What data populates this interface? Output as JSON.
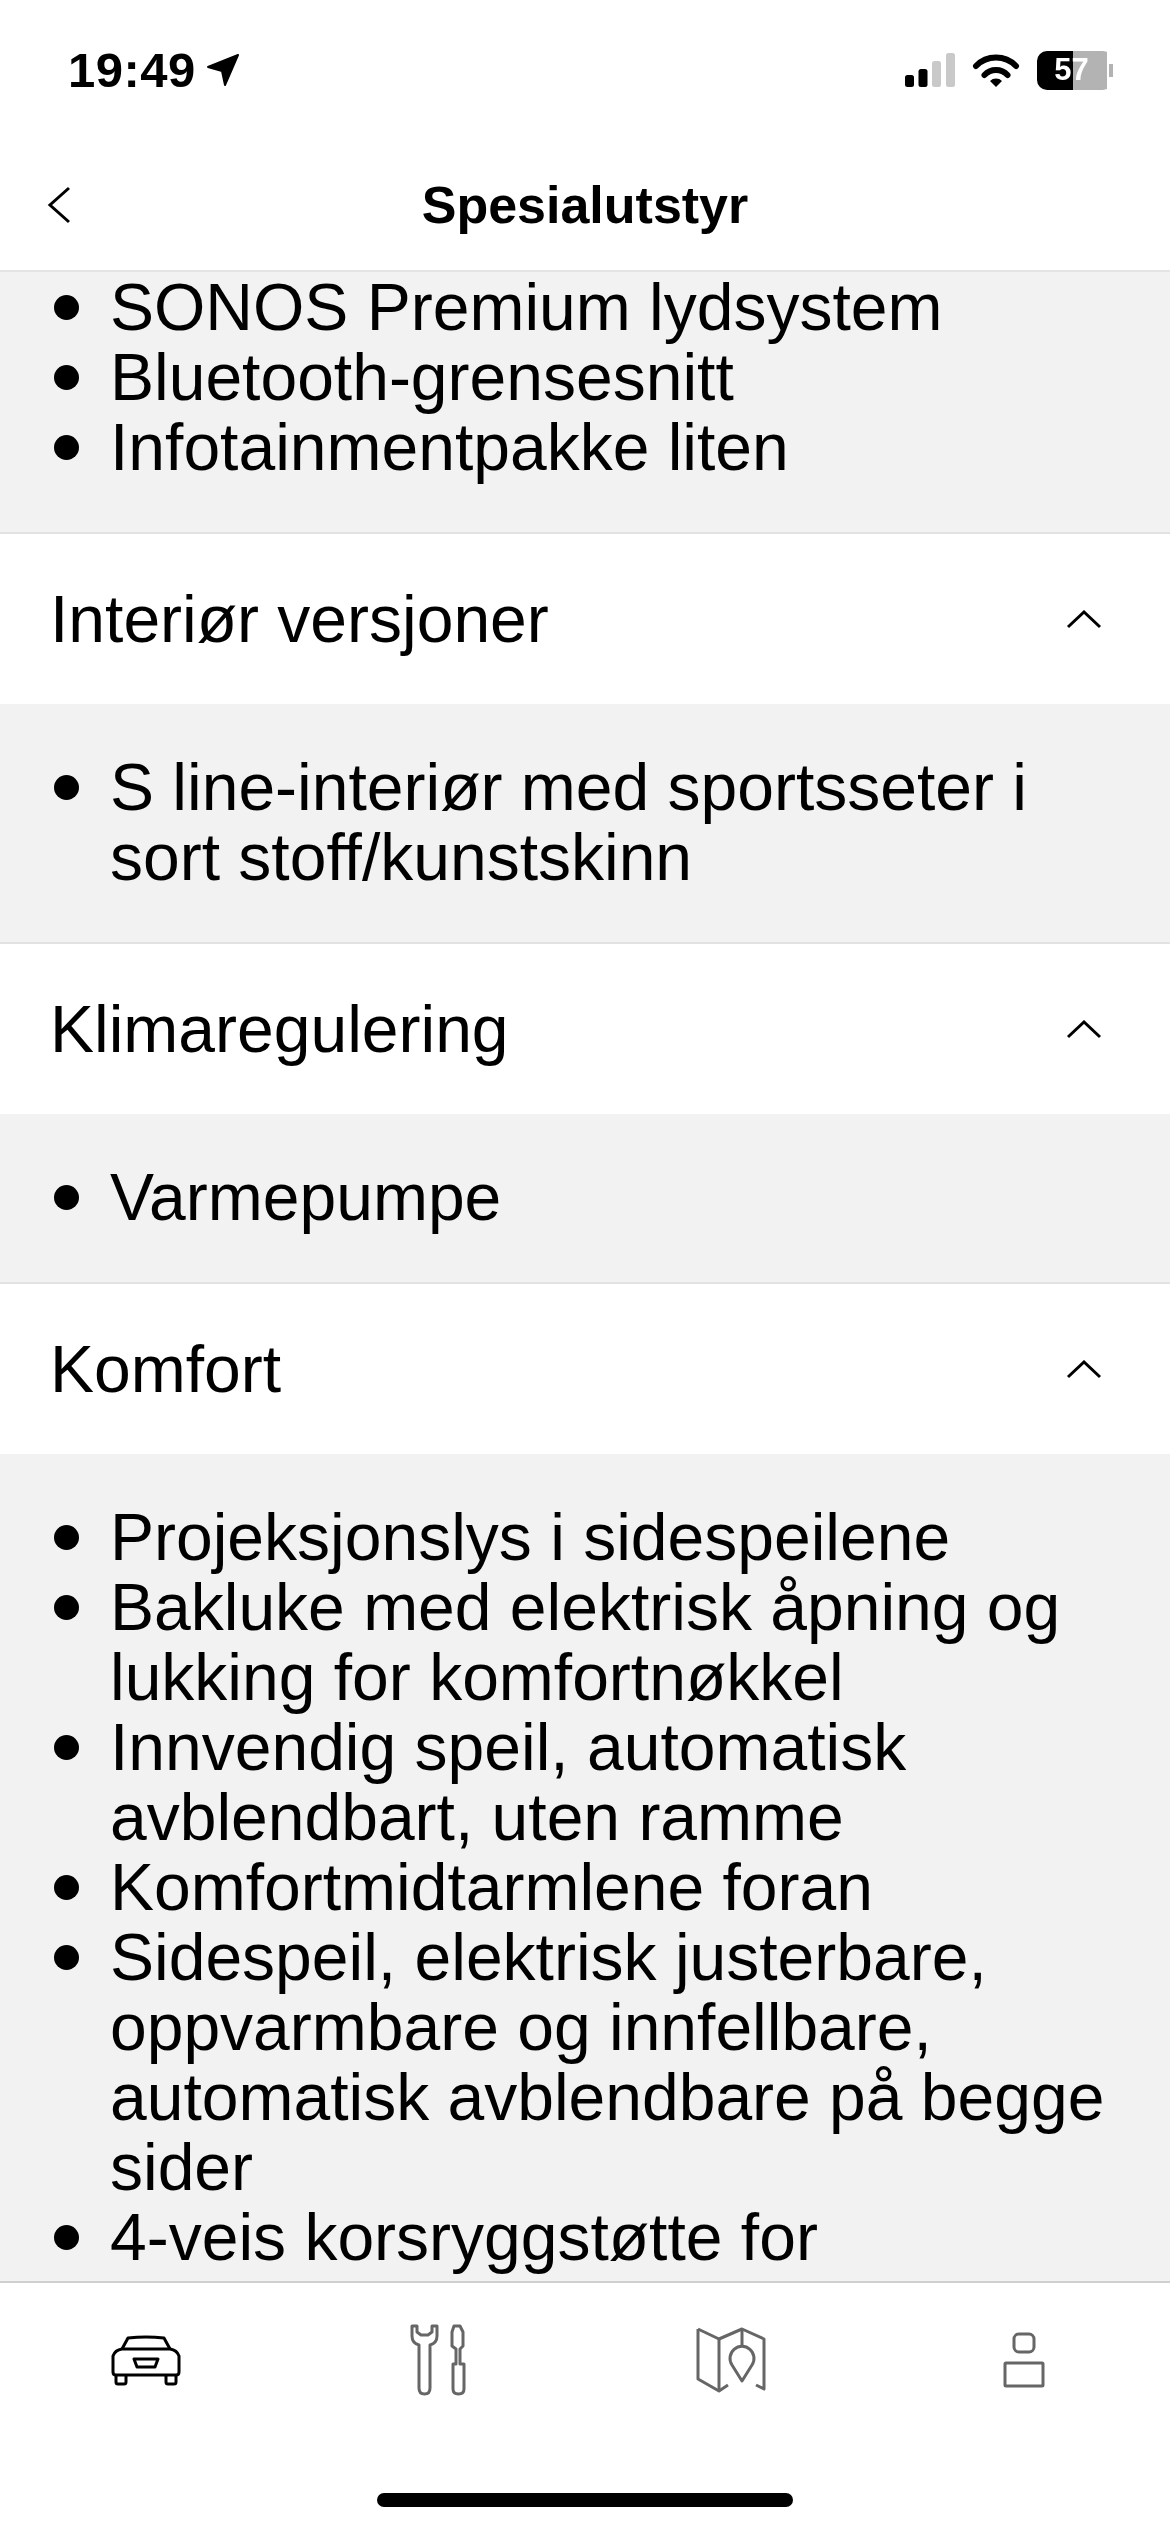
{
  "status_bar": {
    "time": "19:49",
    "battery": "57"
  },
  "header": {
    "title": "Spesialutstyr"
  },
  "sections": [
    {
      "expanded": true,
      "items": [
        "SONOS Premium lydsystem",
        "Bluetooth-grensesnitt",
        "Infotainmentpakke liten"
      ]
    },
    {
      "title": "Interiør versjoner",
      "expanded": true,
      "items": [
        "S line-interiør med sportsseter i sort stoff/kunstskinn"
      ]
    },
    {
      "title": "Klimaregulering",
      "expanded": true,
      "items": [
        "Varmepumpe"
      ]
    },
    {
      "title": "Komfort",
      "expanded": true,
      "items": [
        "Projeksjonslys i sidespeilene",
        "Bakluke med elektrisk åpning og lukking for komfortnøkkel",
        "Innvendig speil, automatisk avblendbart, uten ramme",
        "Komfortmidtarmlene foran",
        "Sidespeil, elektrisk justerbare, oppvarmbare og innfellbare, automatisk avblendbare på begge sider",
        "4-veis korsryggstøtte for"
      ]
    }
  ],
  "tab_bar": {
    "tabs": [
      {
        "kind": "car",
        "selected": true
      },
      {
        "kind": "tools",
        "selected": false
      },
      {
        "kind": "map",
        "selected": false
      },
      {
        "kind": "profile",
        "selected": false
      }
    ]
  }
}
